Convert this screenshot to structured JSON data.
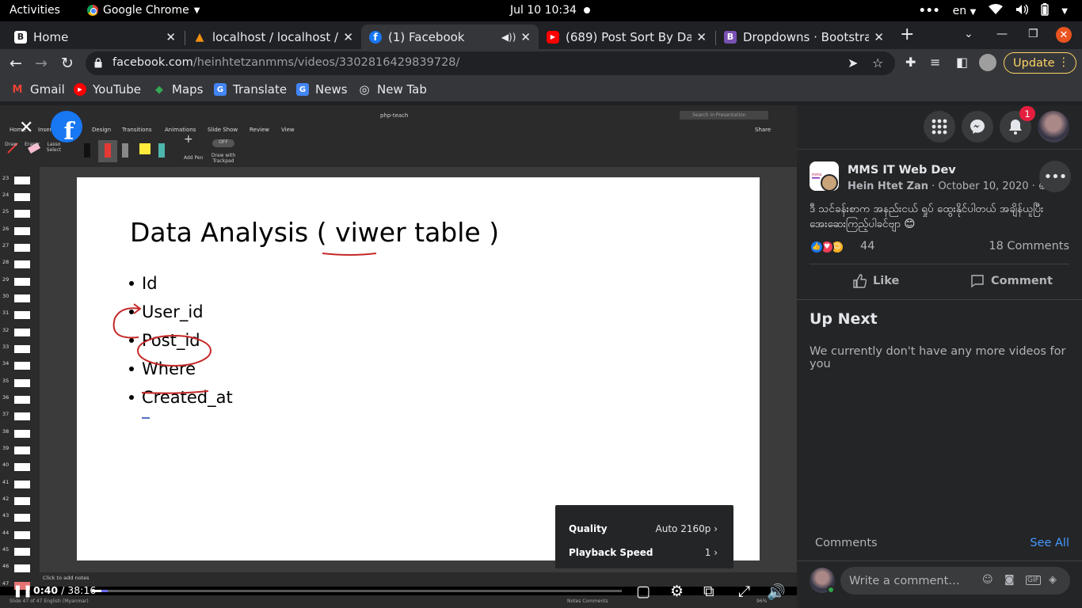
{
  "system": {
    "activities": "Activities",
    "app_name": "Google Chrome",
    "clock": "Jul 10  10:34",
    "lang": "en"
  },
  "tabs": [
    {
      "title": "Home",
      "favicon": "B",
      "favicon_color": "#202124"
    },
    {
      "title": "localhost / localhost / s",
      "favicon": "▲",
      "favicon_color": "#f29111"
    },
    {
      "title": "(1) Facebook",
      "favicon": "f",
      "favicon_color": "#1877f2"
    },
    {
      "title": "(689) Post Sort By Date",
      "favicon": "▶",
      "favicon_color": "#ff0000"
    },
    {
      "title": "Dropdowns · Bootstrap",
      "favicon": "B",
      "favicon_color": "#7952b3"
    }
  ],
  "omnibox": {
    "host": "facebook.com",
    "path": "/heinhtetzanmms/videos/3302816429839728/"
  },
  "update_label": "Update",
  "bookmarks": [
    {
      "label": "Gmail",
      "icon": "gmail-icon",
      "color": "#ea4335",
      "glyph": "M"
    },
    {
      "label": "YouTube",
      "icon": "youtube-icon",
      "color": "#ff0000",
      "glyph": "▶"
    },
    {
      "label": "Maps",
      "icon": "maps-icon",
      "color": "#34a853",
      "glyph": "◆"
    },
    {
      "label": "Translate",
      "icon": "translate-icon",
      "color": "#4285f4",
      "glyph": "G"
    },
    {
      "label": "News",
      "icon": "news-icon",
      "color": "#4285f4",
      "glyph": "G"
    },
    {
      "label": "New Tab",
      "icon": "globe-icon",
      "color": "#5f6368",
      "glyph": "◎"
    }
  ],
  "ppt": {
    "doc_title": "php-teach",
    "search_placeholder": "Search in Presentation",
    "menu": [
      "Home",
      "Insert",
      "Design",
      "Transitions",
      "Animations",
      "Slide Show",
      "Review",
      "View"
    ],
    "share": "Share",
    "tools": [
      "Draw",
      "Eraser",
      "Lasso Select",
      "Add Pen",
      "Draw with Trackpad"
    ],
    "toggle_label": "OFF",
    "slide_numbers": [
      "23",
      "24",
      "25",
      "26",
      "27",
      "28",
      "29",
      "30",
      "31",
      "32",
      "33",
      "34",
      "35",
      "36",
      "37",
      "38",
      "39",
      "40",
      "41",
      "42",
      "43",
      "44",
      "45",
      "46",
      "47"
    ],
    "notes_placeholder": "Click to add notes",
    "status_left": "Slide 47 of 47    English (Myanmar)",
    "status_right": "Notes   Comments",
    "status_zoom": "96%"
  },
  "slide": {
    "title": "Data Analysis ( viwer table )",
    "bullets": [
      "Id",
      "User_id",
      "Post_id",
      "Where",
      "Created_at"
    ]
  },
  "player": {
    "current_time": "0:40",
    "separator": " / ",
    "duration": "38:16",
    "progress_fraction": 0.0174,
    "settings": [
      {
        "label": "Quality",
        "value": "Auto 2160p"
      },
      {
        "label": "Playback Speed",
        "value": "1"
      }
    ]
  },
  "sidebar": {
    "notification_count": "1",
    "page_name": "MMS IT Web Dev",
    "author": "Hein Htet Zan",
    "date": " · October 10, 2020 · ",
    "post_text": "ဒီ သင်ခန်းစာက အနည်းငယ် ရှုပ် ထွေးနိုင်ပါတယ် အချိန်ယူပြီး အေးဆေးကြည့်ပါခင်ဗျာ 😊",
    "reaction_count": "44",
    "comments_count": "18 Comments",
    "like_label": "Like",
    "comment_label": "Comment",
    "up_next_title": "Up Next",
    "up_next_message": "We currently don't have any more videos for you",
    "comments_heading": "Comments",
    "see_all": "See All",
    "comment_placeholder": "Write a comment…"
  }
}
